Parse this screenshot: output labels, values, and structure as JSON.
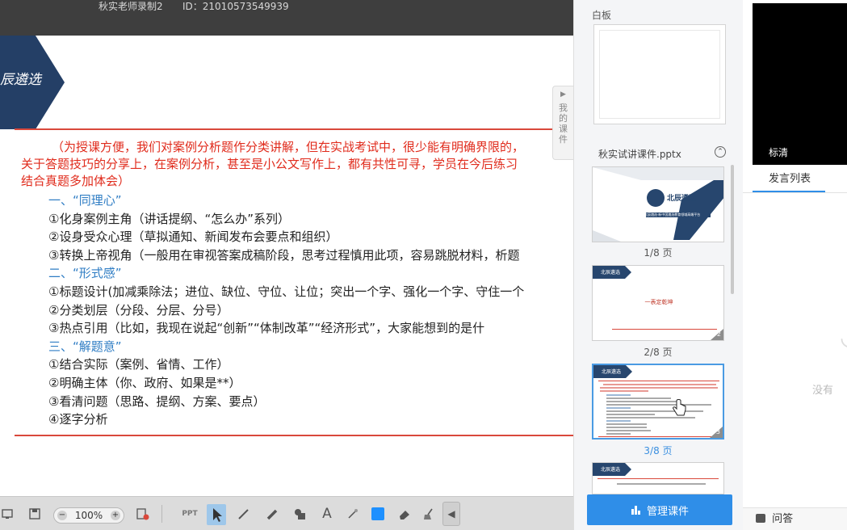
{
  "topbar": {
    "teacher_name": "秋实老师录制2",
    "room_id": "ID：21010573549939"
  },
  "slide": {
    "logo_text": "辰遴选",
    "intro_lines": [
      "（为授课方便，我们对案例分析题作分类讲解，但在实战考试中，很少能有明确界限的，",
      "关于答题技巧的分享上，在案例分析，甚至是小公文写作上，都有共性可寻，学员在今后练习",
      "结合真题多加体会）"
    ],
    "outline": [
      {
        "text": "一、“同理心”",
        "head": true
      },
      {
        "text": "①化身案例主角（讲话提纲、“怎么办”系列）",
        "head": false
      },
      {
        "text": "②设身受众心理（草拟通知、新闻发布会要点和组织）",
        "head": false
      },
      {
        "text": "③转换上帝视角（一般用在审视答案成稿阶段，思考过程慎用此项，容易跳脱材料，析题",
        "head": false
      },
      {
        "text": "二、“形式感”",
        "head": true
      },
      {
        "text": "①标题设计(加减乘除法；进位、缺位、守位、让位；突出一个字、强化一个字、守住一个",
        "head": false
      },
      {
        "text": "②分类划层（分段、分层、分号）",
        "head": false
      },
      {
        "text": "③热点引用（比如，我现在说起“创新”“体制改革”“经济形式”，大家能想到的是什",
        "head": false
      },
      {
        "text": "三、“解题意”",
        "head": true
      },
      {
        "text": "①结合实际（案例、省情、工作）",
        "head": false
      },
      {
        "text": "②明确主体（你、政府、如果是**）",
        "head": false
      },
      {
        "text": "③看清问题（思路、提纲、方案、要点）",
        "head": false
      },
      {
        "text": "④逐字分析",
        "head": false
      }
    ]
  },
  "toolbar": {
    "zoom_value": "100%",
    "zoom_minus": "−",
    "zoom_plus": "+",
    "ppt_label": "PPT",
    "text_tool": "A",
    "collapse": "◀",
    "icons": [
      "screen-icon",
      "save-icon",
      "clear-icon",
      "ppt-icon",
      "pointer-icon",
      "pen-icon",
      "highlighter-icon",
      "shape-icon",
      "text-icon",
      "laser-icon",
      "color-icon",
      "eraser-icon",
      "broom-icon"
    ]
  },
  "side_tab": {
    "arrow": "▶",
    "label": "我的课件"
  },
  "panel": {
    "whiteboard_label": "白板",
    "file_title": "秋实试讲课件.pptx",
    "toggle": "⌃",
    "thumbs": [
      {
        "label": "1/8 页",
        "active": false,
        "num": ""
      },
      {
        "label": "2/8 页",
        "active": false,
        "num": "2"
      },
      {
        "label": "3/8 页",
        "active": true,
        "num": "3"
      }
    ],
    "thumb1_brand": "北辰遴选",
    "thumb1_sub": "北辰遴选·新中国遴选教育领域高端平台",
    "thumb2_brand": "北辰遴选",
    "thumb2_title": "一表定乾坤",
    "thumb3_brand": "北辰遴选",
    "thumb4_brand": "北辰遴选",
    "manage_button": "管理课件"
  },
  "col3": {
    "quality": "标清",
    "speak_tab": "发言列表",
    "empty_text": "没有",
    "qa_label": "问答"
  },
  "colors": {
    "accent": "#2f8ee8",
    "slide_red": "#e02b1c",
    "heading_blue": "#2f7dc4",
    "navy": "#1f3a5f"
  }
}
